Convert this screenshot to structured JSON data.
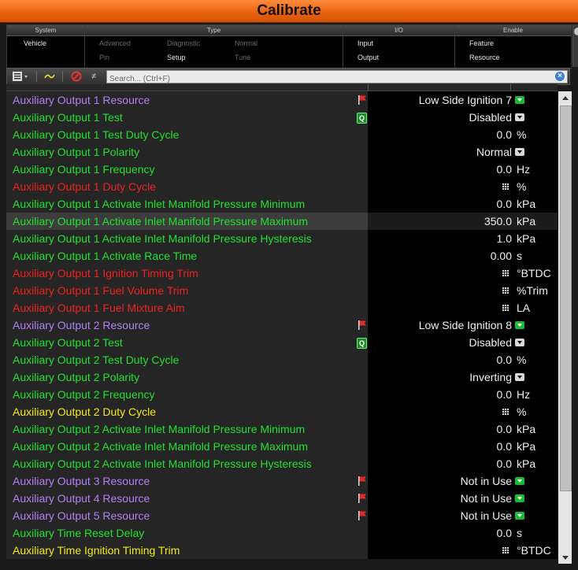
{
  "window": {
    "title": "Calibrate"
  },
  "filters": {
    "system": {
      "header": "System",
      "items": [
        "Vehicle"
      ]
    },
    "type": {
      "header": "Type",
      "items": [
        "Advanced",
        "Diagnostic",
        "Normal",
        "Pin",
        "Setup",
        "Tune"
      ]
    },
    "io": {
      "header": "I/O",
      "items": [
        "Input",
        "Output"
      ]
    },
    "enable": {
      "header": "Enable",
      "items": [
        "Feature",
        "Resource"
      ]
    }
  },
  "toolbar": {
    "view_icon": "list-view-icon",
    "trace_icon": "wave-icon",
    "no_icon": "no-entry-icon",
    "neq_label": "≠"
  },
  "search": {
    "placeholder": "Search... (Ctrl+F)",
    "value": ""
  },
  "colors": {
    "resource": "#b67ef2",
    "normal": "#22e02f",
    "disabled": "#ee2222",
    "warning": "#f2ea1c",
    "title_orange": "#e8600c"
  },
  "rows": [
    {
      "name": "Auxiliary Output 1 Resource",
      "color": "purple",
      "icon": "flag",
      "value": "Low Side Ignition 7",
      "unit": "",
      "control": "dd-green"
    },
    {
      "name": "Auxiliary Output 1 Test",
      "color": "green",
      "icon": "q",
      "value": "Disabled",
      "unit": "",
      "control": "dd-grey"
    },
    {
      "name": "Auxiliary Output 1 Test Duty Cycle",
      "color": "green",
      "icon": "",
      "value": "0.0",
      "unit": "%",
      "control": ""
    },
    {
      "name": "Auxiliary Output 1 Polarity",
      "color": "green",
      "icon": "",
      "value": "Normal",
      "unit": "",
      "control": "dd-grey"
    },
    {
      "name": "Auxiliary Output 1 Frequency",
      "color": "green",
      "icon": "",
      "value": "0.0",
      "unit": "Hz",
      "control": ""
    },
    {
      "name": "Auxiliary Output 1 Duty Cycle",
      "color": "red",
      "icon": "",
      "value": "",
      "unit": "%",
      "control": "table"
    },
    {
      "name": "Auxiliary Output 1 Activate Inlet Manifold Pressure Minimum",
      "color": "green",
      "icon": "",
      "value": "0.0",
      "unit": "kPa",
      "control": ""
    },
    {
      "name": "Auxiliary Output 1 Activate Inlet Manifold Pressure Maximum",
      "color": "green",
      "icon": "",
      "value": "350.0",
      "unit": "kPa",
      "control": "",
      "selected": true
    },
    {
      "name": "Auxiliary Output 1 Activate Inlet Manifold Pressure Hysteresis",
      "color": "green",
      "icon": "",
      "value": "1.0",
      "unit": "kPa",
      "control": ""
    },
    {
      "name": "Auxiliary Output 1 Activate Race Time",
      "color": "green",
      "icon": "",
      "value": "0.00",
      "unit": "s",
      "control": ""
    },
    {
      "name": "Auxiliary Output 1 Ignition Timing Trim",
      "color": "red",
      "icon": "",
      "value": "",
      "unit": "°BTDC",
      "control": "table"
    },
    {
      "name": "Auxiliary Output 1 Fuel Volume Trim",
      "color": "red",
      "icon": "",
      "value": "",
      "unit": "%Trim",
      "control": "table"
    },
    {
      "name": "Auxiliary Output 1 Fuel Mixture Aim",
      "color": "red",
      "icon": "",
      "value": "",
      "unit": "LA",
      "control": "table"
    },
    {
      "name": "Auxiliary Output 2 Resource",
      "color": "purple",
      "icon": "flag",
      "value": "Low Side Ignition 8",
      "unit": "",
      "control": "dd-green"
    },
    {
      "name": "Auxiliary Output 2 Test",
      "color": "green",
      "icon": "q",
      "value": "Disabled",
      "unit": "",
      "control": "dd-grey"
    },
    {
      "name": "Auxiliary Output 2 Test Duty Cycle",
      "color": "green",
      "icon": "",
      "value": "0.0",
      "unit": "%",
      "control": ""
    },
    {
      "name": "Auxiliary Output 2 Polarity",
      "color": "green",
      "icon": "",
      "value": "Inverting",
      "unit": "",
      "control": "dd-grey"
    },
    {
      "name": "Auxiliary Output 2 Frequency",
      "color": "green",
      "icon": "",
      "value": "0.0",
      "unit": "Hz",
      "control": ""
    },
    {
      "name": "Auxiliary Output 2 Duty Cycle",
      "color": "yellow",
      "icon": "",
      "value": "",
      "unit": "%",
      "control": "table"
    },
    {
      "name": "Auxiliary Output 2 Activate Inlet Manifold Pressure Minimum",
      "color": "green",
      "icon": "",
      "value": "0.0",
      "unit": "kPa",
      "control": ""
    },
    {
      "name": "Auxiliary Output 2 Activate Inlet Manifold Pressure Maximum",
      "color": "green",
      "icon": "",
      "value": "0.0",
      "unit": "kPa",
      "control": ""
    },
    {
      "name": "Auxiliary Output 2 Activate Inlet Manifold Pressure Hysteresis",
      "color": "green",
      "icon": "",
      "value": "0.0",
      "unit": "kPa",
      "control": ""
    },
    {
      "name": "Auxiliary Output 3 Resource",
      "color": "purple",
      "icon": "flag",
      "value": "Not in Use",
      "unit": "",
      "control": "dd-green"
    },
    {
      "name": "Auxiliary Output 4 Resource",
      "color": "purple",
      "icon": "flag",
      "value": "Not in Use",
      "unit": "",
      "control": "dd-green"
    },
    {
      "name": "Auxiliary Output 5 Resource",
      "color": "purple",
      "icon": "flag",
      "value": "Not in Use",
      "unit": "",
      "control": "dd-green"
    },
    {
      "name": "Auxiliary Time Reset Delay",
      "color": "green",
      "icon": "",
      "value": "0.0",
      "unit": "s",
      "control": ""
    },
    {
      "name": "Auxiliary Time Ignition Timing Trim",
      "color": "yellow",
      "icon": "",
      "value": "",
      "unit": "°BTDC",
      "control": "table"
    }
  ]
}
